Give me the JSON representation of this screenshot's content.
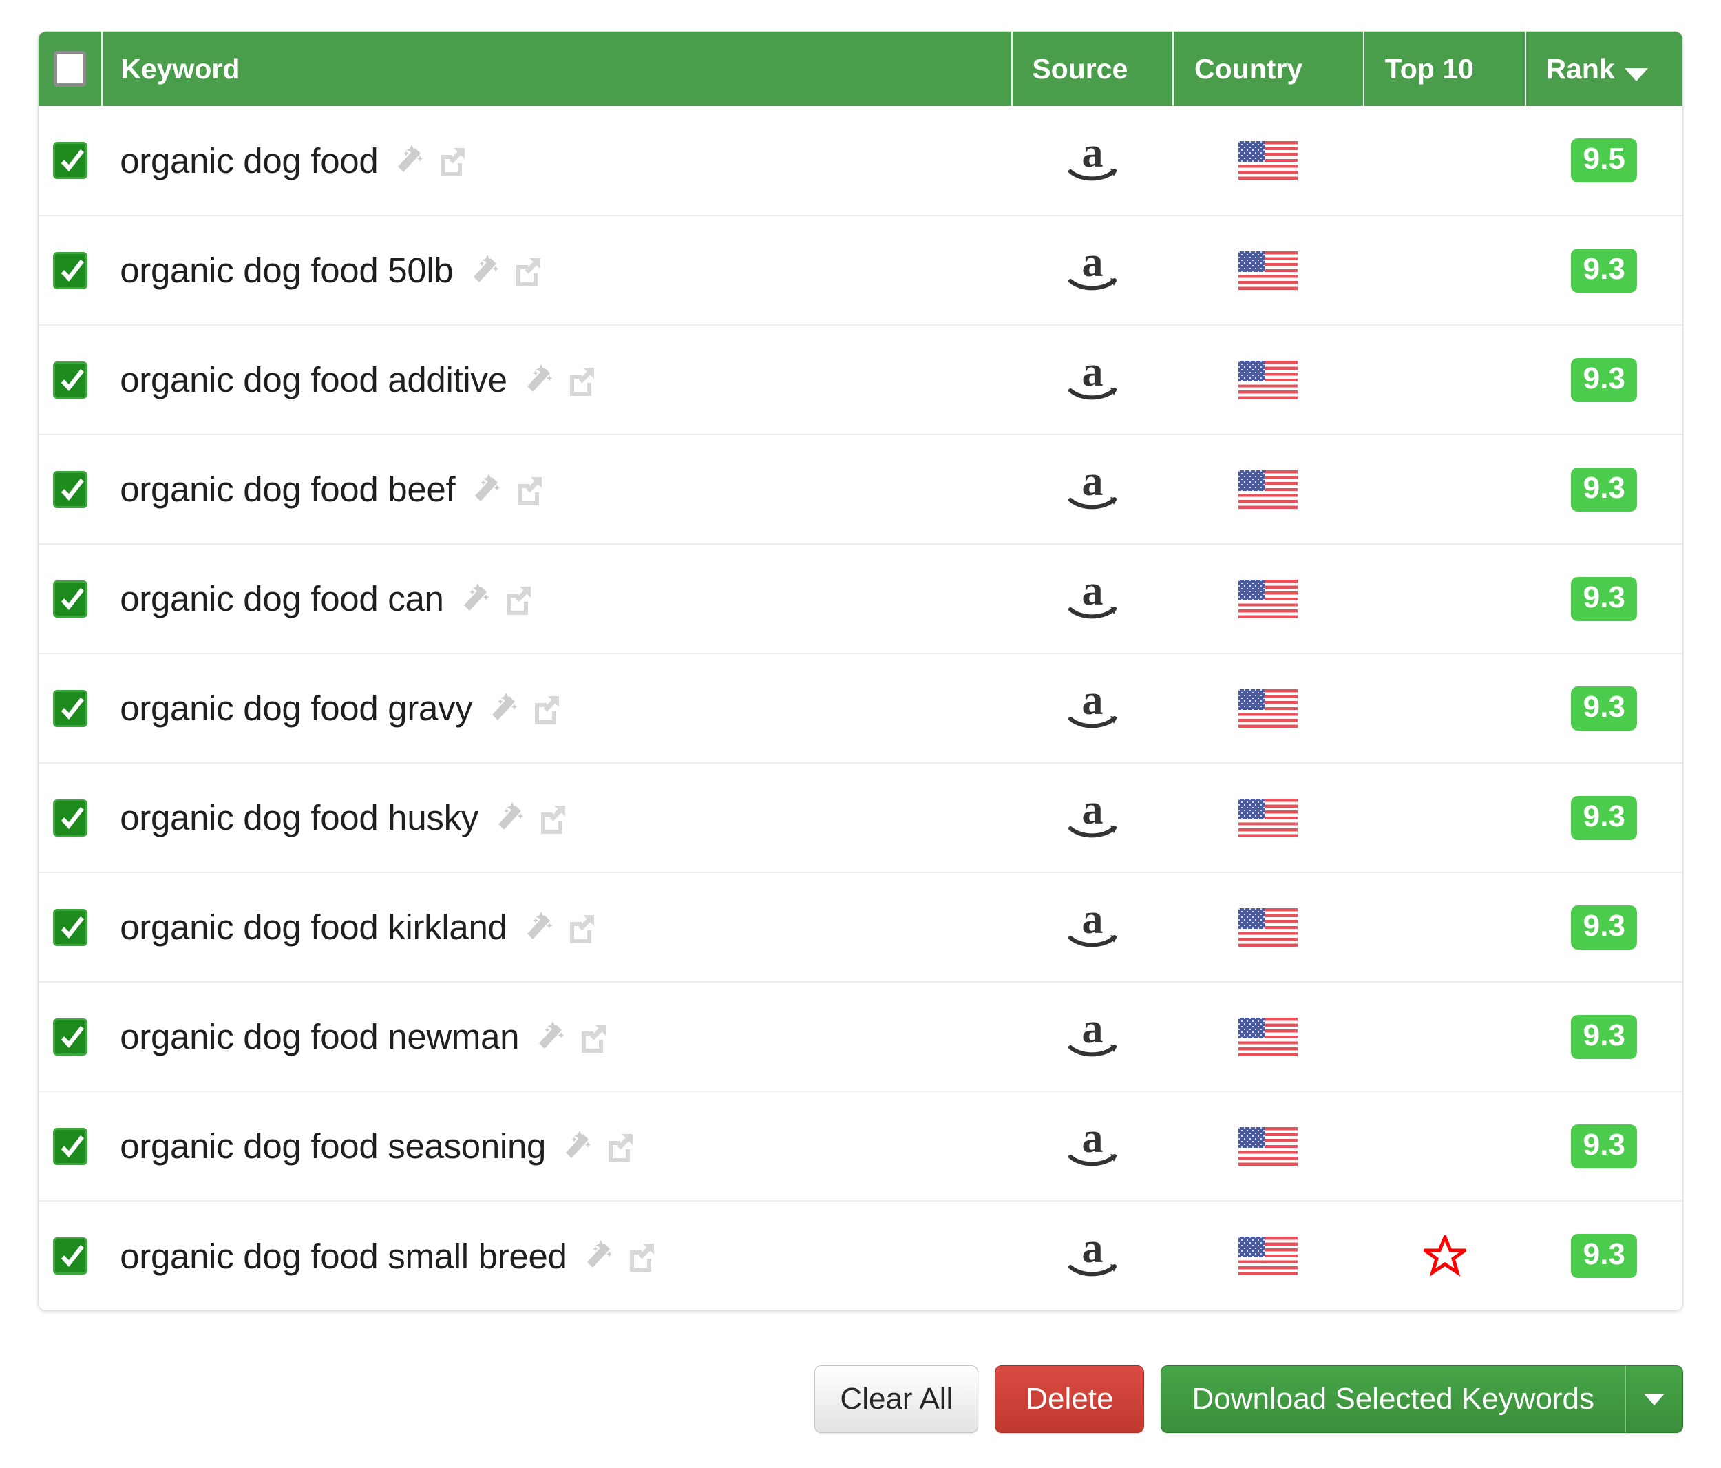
{
  "table": {
    "columns": [
      {
        "key": "check",
        "label": ""
      },
      {
        "key": "keyword",
        "label": "Keyword"
      },
      {
        "key": "source",
        "label": "Source"
      },
      {
        "key": "country",
        "label": "Country"
      },
      {
        "key": "top10",
        "label": "Top 10"
      },
      {
        "key": "rank",
        "label": "Rank"
      }
    ],
    "header": {
      "select_all_checkbox": "unchecked",
      "select_all_icon": "checkbox-unchecked-icon",
      "sort_column": "Rank",
      "sort_direction": "descending",
      "sort_icon": "caret-down-icon"
    },
    "row_icons": {
      "checkbox_checked_icon": "checkbox-checked-icon",
      "wand_icon": "magic-wand-icon",
      "external_link_icon": "external-link-icon",
      "source_icon": "amazon-logo-icon",
      "country_icon": "us-flag-icon",
      "top10_icon": "star-outline-icon"
    },
    "rows": [
      {
        "checked": true,
        "keyword": "organic dog food",
        "source": "amazon",
        "country": "US",
        "top10": false,
        "rank": "9.5"
      },
      {
        "checked": true,
        "keyword": "organic dog food 50lb",
        "source": "amazon",
        "country": "US",
        "top10": false,
        "rank": "9.3"
      },
      {
        "checked": true,
        "keyword": "organic dog food additive",
        "source": "amazon",
        "country": "US",
        "top10": false,
        "rank": "9.3"
      },
      {
        "checked": true,
        "keyword": "organic dog food beef",
        "source": "amazon",
        "country": "US",
        "top10": false,
        "rank": "9.3"
      },
      {
        "checked": true,
        "keyword": "organic dog food can",
        "source": "amazon",
        "country": "US",
        "top10": false,
        "rank": "9.3"
      },
      {
        "checked": true,
        "keyword": "organic dog food gravy",
        "source": "amazon",
        "country": "US",
        "top10": false,
        "rank": "9.3"
      },
      {
        "checked": true,
        "keyword": "organic dog food husky",
        "source": "amazon",
        "country": "US",
        "top10": false,
        "rank": "9.3"
      },
      {
        "checked": true,
        "keyword": "organic dog food kirkland",
        "source": "amazon",
        "country": "US",
        "top10": false,
        "rank": "9.3"
      },
      {
        "checked": true,
        "keyword": "organic dog food newman",
        "source": "amazon",
        "country": "US",
        "top10": false,
        "rank": "9.3"
      },
      {
        "checked": true,
        "keyword": "organic dog food seasoning",
        "source": "amazon",
        "country": "US",
        "top10": false,
        "rank": "9.3"
      },
      {
        "checked": true,
        "keyword": "organic dog food small breed",
        "source": "amazon",
        "country": "US",
        "top10": true,
        "rank": "9.3"
      }
    ]
  },
  "footer": {
    "clear_all_label": "Clear All",
    "delete_label": "Delete",
    "download_label": "Download Selected Keywords",
    "download_caret_icon": "caret-down-icon"
  },
  "colors": {
    "header_green": "#4a9d4a",
    "checkbox_green": "#1d8a1d",
    "rank_badge_green": "#4ccc4c",
    "delete_red": "#c0392e",
    "download_green": "#3b8f3b",
    "star_red": "#ff0000",
    "keyword_text": "#1f1f1f",
    "icon_gray": "#cfcfcf"
  }
}
